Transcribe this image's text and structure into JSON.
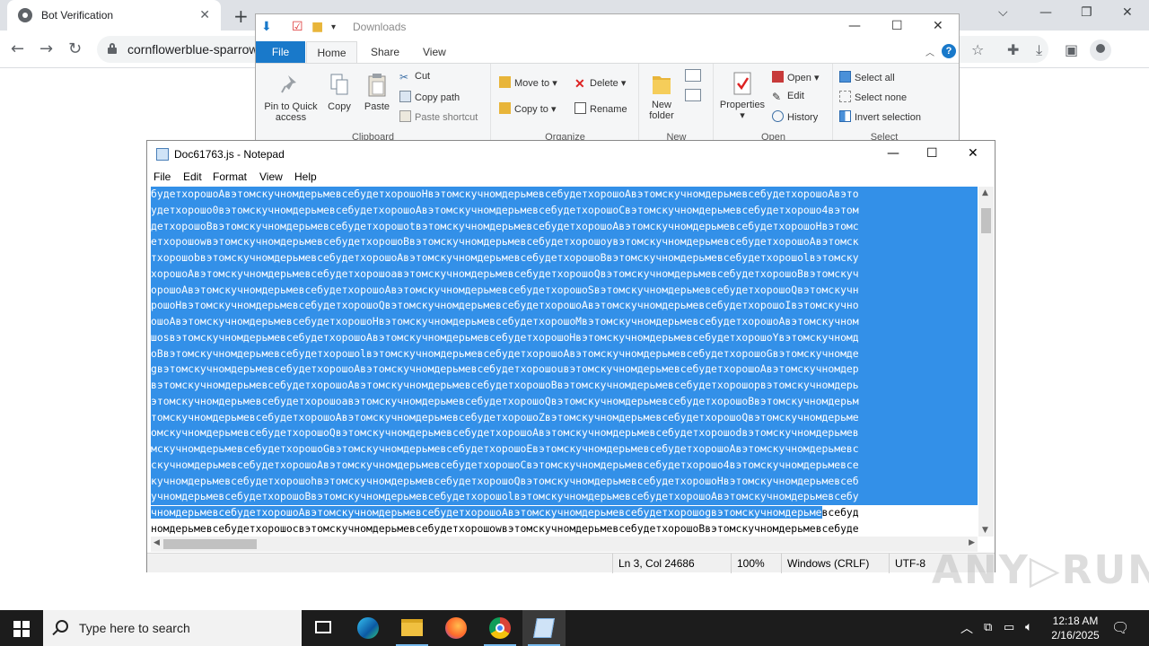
{
  "browser": {
    "tab_title": "Bot Verification",
    "tab_close": "✕",
    "new_tab": "+",
    "url": "cornflowerblue-sparrow",
    "window_controls": [
      "⌵",
      "—",
      "❐",
      "✕"
    ]
  },
  "explorer": {
    "title": "Downloads",
    "tabs": [
      "File",
      "Home",
      "Share",
      "View"
    ],
    "groups": {
      "clipboard": {
        "label": "Clipboard",
        "pin": "Pin to Quick access",
        "copy": "Copy",
        "paste": "Paste",
        "cut": "Cut",
        "copy_path": "Copy path",
        "paste_shortcut": "Paste shortcut"
      },
      "organize": {
        "label": "Organize",
        "move_to": "Move to",
        "copy_to": "Copy to",
        "delete": "Delete",
        "rename": "Rename"
      },
      "new": {
        "label": "New",
        "new_folder": "New folder"
      },
      "open": {
        "label": "Open",
        "properties": "Properties",
        "open": "Open",
        "edit": "Edit",
        "history": "History"
      },
      "select": {
        "label": "Select",
        "select_all": "Select all",
        "select_none": "Select none",
        "invert": "Invert selection"
      }
    }
  },
  "notepad": {
    "title": "Doc61763.js - Notepad",
    "menu": [
      "File",
      "Edit",
      "Format",
      "View",
      "Help"
    ],
    "lines": [
      "будетхорошоAвэтомскучномдерьмевсебудетхорошоHвэтомскучномдерьмевсебудетхорошоAвэтомскучномдерьмевсебудетхорошоAвэто",
      "удетхорошо0вэтомскучномдерьмевсебудетхорошоAвэтомскучномдерьмевсебудетхорошоCвэтомскучномдерьмевсебудетхорошо4вэтом",
      "детхорошоBвэтомскучномдерьмевсебудетхорошоtвэтомскучномдерьмевсебудетхорошоAвэтомскучномдерьмевсебудетхорошоHвэтомс",
      "етхорошоwвэтомскучномдерьмевсебудетхорошоBвэтомскучномдерьмевсебудетхорошоyвэтомскучномдерьмевсебудетхорошоAвэтомск",
      "тхорошоbвэтомскучномдерьмевсебудетхорошоAвэтомскучномдерьмевсебудетхорошоBвэтомскучномдерьмевсебудетхорошоlвэтомску",
      "хорошоAвэтомскучномдерьмевсебудетхорошоaвэтомскучномдерьмевсебудетхорошоQвэтомскучномдерьмевсебудетхорошоBвэтомскуч",
      "орошоAвэтомскучномдерьмевсебудетхорошоAвэтомскучномдерьмевсебудетхорошоSвэтомскучномдерьмевсебудетхорошоQвэтомскучн",
      "рошоHвэтомскучномдерьмевсебудетхорошоQвэтомскучномдерьмевсебудетхорошоAвэтомскучномдерьмевсебудетхорошоIвэтомскучно",
      "ошоAвэтомскучномдерьмевсебудетхорошоHвэтомскучномдерьмевсебудетхорошоMвэтомскучномдерьмевсебудетхорошоAвэтомскучном",
      "шоsвэтомскучномдерьмевсебудетхорошоAвэтомскучномдерьмевсебудетхорошоHвэтомскучномдерьмевсебудетхорошоYвэтомскучномд",
      "оBвэтомскучномдерьмевсебудетхорошоlвэтомскучномдерьмевсебудетхорошоAвэтомскучномдерьмевсебудетхорошоGвэтомскучномде",
      "gвэтомскучномдерьмевсебудетхорошоAвэтомскучномдерьмевсебудетхорошоuвэтомскучномдерьмевсебудетхорошоAвэтомскучномдер",
      "вэтомскучномдерьмевсебудетхорошоAвэтомскучномдерьмевсебудетхорошоBвэтомскучномдерьмевсебудетхорошорвэтомскучномдерь",
      "этомскучномдерьмевсебудетхорошоaвэтомскучномдерьмевсебудетхорошоQвэтомскучномдерьмевсебудетхорошоBвэтомскучномдерьм",
      "томскучномдерьмевсебудетхорошоAвэтомскучномдерьмевсебудетхорошоZвэтомскучномдерьмевсебудетхорошоQвэтомскучномдерьме",
      "омскучномдерьмевсебудетхорошоQвэтомскучномдерьмевсебудетхорошоAвэтомскучномдерьмевсебудетхорошоdвэтомскучномдерьмев",
      "мскучномдерьмевсебудетхорошоGвэтомскучномдерьмевсебудетхорошоEвэтомскучномдерьмевсебудетхорошоAвэтомскучномдерьмевс",
      "скучномдерьмевсебудетхорошоAвэтомскучномдерьмевсебудетхорошоCвэтомскучномдерьмевсебудетхорошо4вэтомскучномдерьмевсе",
      "кучномдерьмевсебудетхорошоhвэтомскучномдерьмевсебудетхорошоQвэтомскучномдерьмевсебудетхорошоHвэтомскучномдерьмевсеб",
      "учномдерьмевсебудетхорошоBвэтомскучномдерьмевсебудетхорошоlвэтомскучномдерьмевсебудетхорошоAвэтомскучномдерьмевсебу"
    ],
    "partial_line_selected": "чномдерьмевсебудетхорошоAвэтомскучномдерьмевсебудетхорошоAвэтомскучномдерьмевсебудетхорошоgвэтомскучномдерьме",
    "partial_line_rest": "всебуд",
    "last_line": "номдерьмевсебудетхорошоcвэтомскучномдерьмевсебудетхорошоwвэтомскучномдерьмевсебудетхорошоBвэтомскучномдерьмевсебуде",
    "status": {
      "position": "Ln 3, Col 24686",
      "zoom": "100%",
      "line_ending": "Windows (CRLF)",
      "encoding": "UTF-8"
    },
    "window_controls": [
      "—",
      "☐",
      "✕"
    ]
  },
  "watermark": "ANY▷RUN",
  "taskbar": {
    "search_placeholder": "Type here to search",
    "time": "12:18 AM",
    "date": "2/16/2025"
  },
  "colors": {
    "selection": "#3390e8",
    "explorer_file_tab": "#1979ca",
    "taskbar": "#1c1c1c"
  }
}
